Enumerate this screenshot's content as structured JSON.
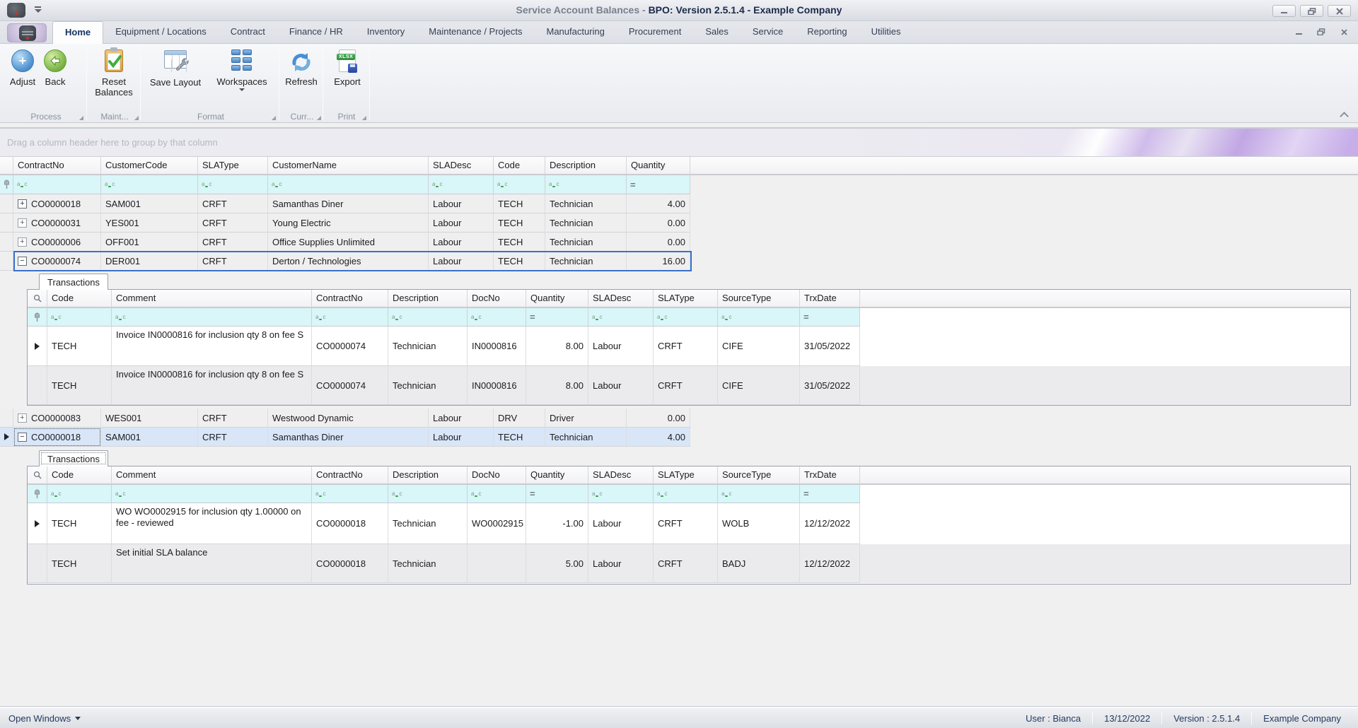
{
  "titlebar": {
    "title_gray": "Service Account Balances -",
    "title_bold": "BPO: Version 2.5.1.4 - Example Company"
  },
  "tabs": {
    "items": [
      {
        "label": "Home"
      },
      {
        "label": "Equipment / Locations"
      },
      {
        "label": "Contract"
      },
      {
        "label": "Finance / HR"
      },
      {
        "label": "Inventory"
      },
      {
        "label": "Maintenance / Projects"
      },
      {
        "label": "Manufacturing"
      },
      {
        "label": "Procurement"
      },
      {
        "label": "Sales"
      },
      {
        "label": "Service"
      },
      {
        "label": "Reporting"
      },
      {
        "label": "Utilities"
      }
    ]
  },
  "ribbon": {
    "buttons": {
      "adjust": "Adjust",
      "back": "Back",
      "reset": "Reset Balances",
      "save_layout": "Save Layout",
      "workspaces": "Workspaces",
      "refresh": "Refresh",
      "export": "Export"
    },
    "export_badge": "XLSX",
    "groups": {
      "process": "Process",
      "maint": "Maint...",
      "format": "Format",
      "curr": "Curr...",
      "print": "Print"
    }
  },
  "grid": {
    "group_panel": "Drag a column header here to group by that column",
    "columns": [
      "ContractNo",
      "CustomerCode",
      "SLAType",
      "CustomerName",
      "SLADesc",
      "Code",
      "Description",
      "Quantity"
    ],
    "rows": [
      [
        "CO0000018",
        "SAM001",
        "CRFT",
        "Samanthas Diner",
        "Labour",
        "TECH",
        "Technician",
        "4.00"
      ],
      [
        "CO0000031",
        "YES001",
        "CRFT",
        "Young Electric",
        "Labour",
        "TECH",
        "Technician",
        "0.00"
      ],
      [
        "CO0000006",
        "OFF001",
        "CRFT",
        "Office Supplies Unlimited",
        "Labour",
        "TECH",
        "Technician",
        "0.00"
      ],
      [
        "CO0000074",
        "DER001",
        "CRFT",
        "Derton / Technologies",
        "Labour",
        "TECH",
        "Technician",
        "16.00"
      ],
      [
        "CO0000083",
        "WES001",
        "CRFT",
        "Westwood Dynamic",
        "Labour",
        "DRV",
        "Driver",
        "0.00"
      ],
      [
        "CO0000018",
        "SAM001",
        "CRFT",
        "Samanthas Diner",
        "Labour",
        "TECH",
        "Technician",
        "4.00"
      ]
    ]
  },
  "detail1": {
    "tab": "Transactions",
    "columns": [
      "Code",
      "Comment",
      "ContractNo",
      "Description",
      "DocNo",
      "Quantity",
      "SLADesc",
      "SLAType",
      "SourceType",
      "TrxDate"
    ],
    "rows": [
      [
        "TECH",
        "Invoice IN0000816 for inclusion qty 8 on fee S",
        "CO0000074",
        "Technician",
        "IN0000816",
        "8.00",
        "Labour",
        "CRFT",
        "CIFE",
        "31/05/2022"
      ],
      [
        "TECH",
        "Invoice IN0000816 for inclusion qty 8 on fee S",
        "CO0000074",
        "Technician",
        "IN0000816",
        "8.00",
        "Labour",
        "CRFT",
        "CIFE",
        "31/05/2022"
      ]
    ]
  },
  "detail2": {
    "tab": "Transactions",
    "columns": [
      "Code",
      "Comment",
      "ContractNo",
      "Description",
      "DocNo",
      "Quantity",
      "SLADesc",
      "SLAType",
      "SourceType",
      "TrxDate"
    ],
    "rows": [
      [
        "TECH",
        "WO WO0002915 for inclusion qty 1.00000 on fee - reviewed",
        "CO0000018",
        "Technician",
        "WO0002915",
        "-1.00",
        "Labour",
        "CRFT",
        "WOLB",
        "12/12/2022"
      ],
      [
        "TECH",
        "Set initial SLA balance",
        "CO0000018",
        "Technician",
        "",
        "5.00",
        "Labour",
        "CRFT",
        "BADJ",
        "12/12/2022"
      ]
    ]
  },
  "statusbar": {
    "open_windows": "Open Windows",
    "user": "User : Bianca",
    "date": "13/12/2022",
    "version": "Version : 2.5.1.4",
    "company": "Example Company"
  }
}
